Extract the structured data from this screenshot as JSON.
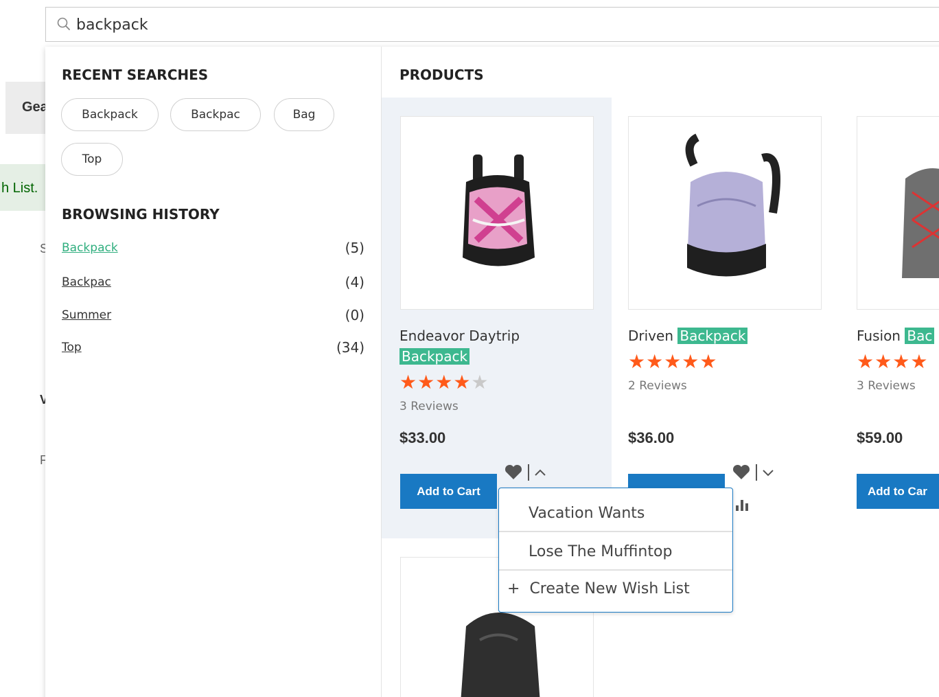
{
  "search": {
    "value": "backpack"
  },
  "background": {
    "tab_label": "Gea",
    "message_text": "h List.",
    "frag1": "S",
    "frag2": "V",
    "frag3": "F"
  },
  "recent_searches": {
    "title": "RECENT SEARCHES",
    "chips": [
      "Backpack",
      "Backpac",
      "Bag",
      "Top"
    ]
  },
  "browsing_history": {
    "title": "BROWSING HISTORY",
    "items": [
      {
        "label": "Backpack",
        "count": "(5)"
      },
      {
        "label": "Backpac",
        "count": "(4)"
      },
      {
        "label": "Summer",
        "count": "(0)"
      },
      {
        "label": "Top",
        "count": "(34)"
      }
    ]
  },
  "products": {
    "title": "PRODUCTS",
    "items": [
      {
        "name_prefix": "Endeavor Daytrip",
        "name_highlight": "Backpack",
        "rating": 3.5,
        "reviews": "3  Reviews",
        "price": "$33.00",
        "button": "Add to Cart"
      },
      {
        "name_prefix": "Driven",
        "name_highlight": "Backpack",
        "rating": 4.5,
        "reviews": "2  Reviews",
        "price": "$36.00",
        "button": "Add to Cart"
      },
      {
        "name_prefix": "Fusion",
        "name_highlight": "Bac",
        "rating": 3.5,
        "reviews": "3  Reviews",
        "price": "$59.00",
        "button": "Add to Car"
      }
    ]
  },
  "wishlist_popup": {
    "items": [
      "Vacation Wants",
      "Lose The Muffintop"
    ],
    "create_label": "Create New Wish List",
    "create_symbol": "+"
  },
  "colors": {
    "accent_blue": "#1979c3",
    "highlight_green": "#3db88f",
    "star_orange": "#ff5a1a"
  }
}
